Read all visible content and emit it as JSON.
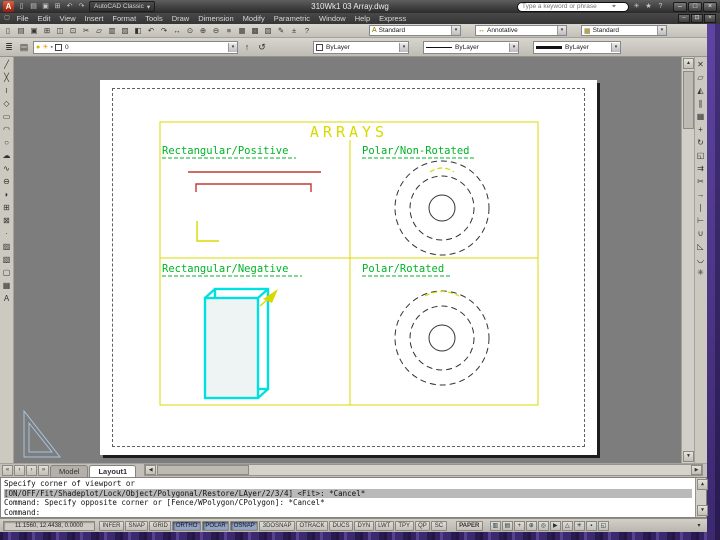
{
  "colors": {
    "cad_yellow": "#d9d900",
    "cad_green": "#00b428",
    "cad_red": "#c03a32",
    "cad_cyan": "#00e0e0",
    "desktop_purple": "#4b2d8e",
    "chrome_dark": "#3a3a3a",
    "canvas_gray": "#7d7d7d"
  },
  "ui": {
    "dropdown_arrow": "▾",
    "search_icon": "⌖",
    "scroll_up": "▲",
    "scroll_down": "▼",
    "scroll_left": "◀",
    "scroll_right": "▶"
  },
  "titlebar": {
    "logo": "A",
    "workspace": "AutoCAD Classic",
    "doc_title": "310Wk1 03 Array.dwg",
    "search_placeholder": "Type a keyword or phrase",
    "qat_icons": [
      {
        "name": "qnew-icon",
        "glyph": "▯"
      },
      {
        "name": "open-icon",
        "glyph": "▤"
      },
      {
        "name": "save-icon",
        "glyph": "▣"
      },
      {
        "name": "plot-icon",
        "glyph": "⊞"
      },
      {
        "name": "undo-icon",
        "glyph": "↶"
      },
      {
        "name": "redo-icon",
        "glyph": "↷"
      }
    ],
    "right_icons": [
      {
        "name": "communication-center-icon",
        "glyph": "☀"
      },
      {
        "name": "favorites-icon",
        "glyph": "★"
      },
      {
        "name": "help-icon",
        "glyph": "?"
      }
    ],
    "window_buttons": [
      {
        "name": "app-minimize-button",
        "glyph": "–"
      },
      {
        "name": "app-maximize-button",
        "glyph": "□"
      },
      {
        "name": "app-close-button",
        "glyph": "×"
      }
    ]
  },
  "menubar": {
    "items": [
      "File",
      "Edit",
      "View",
      "Insert",
      "Format",
      "Tools",
      "Draw",
      "Dimension",
      "Modify",
      "Parametric",
      "Window",
      "Help",
      "Express"
    ],
    "window_buttons": [
      {
        "name": "doc-minimize-button",
        "glyph": "–"
      },
      {
        "name": "doc-restore-button",
        "glyph": "⊡"
      },
      {
        "name": "doc-close-button",
        "glyph": "×"
      }
    ]
  },
  "toolbar1": {
    "icons": [
      {
        "name": "qnew-icon",
        "glyph": "▯"
      },
      {
        "name": "open-icon",
        "glyph": "▤"
      },
      {
        "name": "save-icon",
        "glyph": "▣"
      },
      {
        "name": "plot-icon",
        "glyph": "⊞"
      },
      {
        "name": "plot-preview-icon",
        "glyph": "◫"
      },
      {
        "name": "publish-icon",
        "glyph": "⊡"
      },
      {
        "name": "cut-icon",
        "glyph": "✂"
      },
      {
        "name": "copy-clip-icon",
        "glyph": "▱"
      },
      {
        "name": "paste-icon",
        "glyph": "▥"
      },
      {
        "name": "match-properties-icon",
        "glyph": "▨"
      },
      {
        "name": "block-editor-icon",
        "glyph": "◧"
      },
      {
        "name": "undo-icon",
        "glyph": "↶"
      },
      {
        "name": "redo-icon",
        "glyph": "↷"
      },
      {
        "name": "pan-icon",
        "glyph": "↔"
      },
      {
        "name": "zoom-realtime-icon",
        "glyph": "⊙"
      },
      {
        "name": "zoom-window-icon",
        "glyph": "⊕"
      },
      {
        "name": "zoom-previous-icon",
        "glyph": "⊖"
      },
      {
        "name": "properties-icon",
        "glyph": "≡"
      },
      {
        "name": "designcenter-icon",
        "glyph": "▦"
      },
      {
        "name": "tool-palettes-icon",
        "glyph": "▩"
      },
      {
        "name": "sheetset-manager-icon",
        "glyph": "▧"
      },
      {
        "name": "markup-icon",
        "glyph": "✎"
      },
      {
        "name": "quickcalc-icon",
        "glyph": "±"
      },
      {
        "name": "help-icon",
        "glyph": "?"
      }
    ]
  },
  "styles": {
    "text_style_icon": "A",
    "text_style": "Standard",
    "dim_style_icon": "↔",
    "dim_style": "Annotative",
    "table_style_icon": "▦",
    "table_style": "Standard"
  },
  "layers": {
    "current": "0",
    "indicators": [
      {
        "glyph": "●"
      },
      {
        "glyph": "☀"
      },
      {
        "glyph": "▪"
      }
    ],
    "left_icons": [
      {
        "name": "layer-properties-icon",
        "glyph": "≣"
      },
      {
        "name": "layer-states-icon",
        "glyph": "▤"
      }
    ],
    "mid_icons": [
      {
        "name": "make-object-layer-current-icon",
        "glyph": "↑"
      },
      {
        "name": "layer-previous-icon",
        "glyph": "↺"
      }
    ]
  },
  "properties": {
    "color": "ByLayer",
    "linetype": "ByLayer",
    "lineweight": "ByLayer"
  },
  "draw_toolbar": {
    "icons": [
      {
        "name": "line-icon",
        "glyph": "╱"
      },
      {
        "name": "construction-line-icon",
        "glyph": "╳"
      },
      {
        "name": "polyline-icon",
        "glyph": "≀"
      },
      {
        "name": "polygon-icon",
        "glyph": "◇"
      },
      {
        "name": "rectangle-icon",
        "glyph": "▭"
      },
      {
        "name": "arc-icon",
        "glyph": "◠"
      },
      {
        "name": "circle-icon",
        "glyph": "○"
      },
      {
        "name": "revision-cloud-icon",
        "glyph": "☁"
      },
      {
        "name": "spline-icon",
        "glyph": "∿"
      },
      {
        "name": "ellipse-icon",
        "glyph": "⊖"
      },
      {
        "name": "ellipse-arc-icon",
        "glyph": "◗"
      },
      {
        "name": "insert-block-icon",
        "glyph": "⊞"
      },
      {
        "name": "make-block-icon",
        "glyph": "⊠"
      },
      {
        "name": "point-icon",
        "glyph": "·"
      },
      {
        "name": "hatch-icon",
        "glyph": "▨"
      },
      {
        "name": "gradient-icon",
        "glyph": "▧"
      },
      {
        "name": "region-icon",
        "glyph": "▢"
      },
      {
        "name": "table-icon",
        "glyph": "▦"
      },
      {
        "name": "multiline-text-icon",
        "glyph": "A"
      }
    ]
  },
  "modify_toolbar": {
    "icons": [
      {
        "name": "erase-icon",
        "glyph": "✕"
      },
      {
        "name": "copy-icon",
        "glyph": "▱"
      },
      {
        "name": "mirror-icon",
        "glyph": "◭"
      },
      {
        "name": "offset-icon",
        "glyph": "∥"
      },
      {
        "name": "array-icon",
        "glyph": "▦"
      },
      {
        "name": "move-icon",
        "glyph": "+"
      },
      {
        "name": "rotate-icon",
        "glyph": "↻"
      },
      {
        "name": "scale-icon",
        "glyph": "◱"
      },
      {
        "name": "stretch-icon",
        "glyph": "⇉"
      },
      {
        "name": "trim-icon",
        "glyph": "✂"
      },
      {
        "name": "extend-icon",
        "glyph": "→"
      },
      {
        "name": "break-at-point-icon",
        "glyph": "∣"
      },
      {
        "name": "break-icon",
        "glyph": "⊢"
      },
      {
        "name": "join-icon",
        "glyph": "∪"
      },
      {
        "name": "chamfer-icon",
        "glyph": "◺"
      },
      {
        "name": "fillet-icon",
        "glyph": "◡"
      },
      {
        "name": "explode-icon",
        "glyph": "✳"
      }
    ]
  },
  "drawing": {
    "title": "ARRAYS",
    "labels": {
      "top_left": "Rectangular/Positive",
      "top_right": "Polar/Non-Rotated",
      "bottom_left": "Rectangular/Negative",
      "bottom_right": "Polar/Rotated"
    }
  },
  "tabs": {
    "nav": [
      {
        "name": "tab-first-button",
        "glyph": "«"
      },
      {
        "name": "tab-prev-button",
        "glyph": "‹"
      },
      {
        "name": "tab-next-button",
        "glyph": "›"
      },
      {
        "name": "tab-last-button",
        "glyph": "»"
      }
    ],
    "items": [
      {
        "name": "tab-model",
        "label": "Model",
        "active": false
      },
      {
        "name": "tab-layout1",
        "label": "Layout1",
        "active": true
      }
    ]
  },
  "command": {
    "lines": [
      {
        "text": "Specify corner of viewport or",
        "highlight": false
      },
      {
        "text": "[ON/OFF/Fit/Shadeplot/Lock/Object/Polygonal/Restore/LAyer/2/3/4] <Fit>: *Cancel*",
        "highlight": true
      },
      {
        "text": "Command: Specify opposite corner or [Fence/WPolygon/CPolygon]: *Cancel*",
        "highlight": false
      },
      {
        "text": "Command:",
        "highlight": false
      }
    ]
  },
  "status": {
    "coords": "11.1560, 12.4438, 0.0000",
    "toggles": [
      {
        "name": "toggle-infer",
        "label": "INFER",
        "pressed": false
      },
      {
        "name": "toggle-snap",
        "label": "SNAP",
        "pressed": false
      },
      {
        "name": "toggle-grid",
        "label": "GRID",
        "pressed": false
      },
      {
        "name": "toggle-ortho",
        "label": "ORTHO",
        "pressed": true
      },
      {
        "name": "toggle-polar",
        "label": "POLAR",
        "pressed": true
      },
      {
        "name": "toggle-osnap",
        "label": "OSNAP",
        "pressed": true
      },
      {
        "name": "toggle-3dosnap",
        "label": "3DOSNAP",
        "pressed": false
      },
      {
        "name": "toggle-otrack",
        "label": "OTRACK",
        "pressed": false
      },
      {
        "name": "toggle-ducs",
        "label": "DUCS",
        "pressed": false
      },
      {
        "name": "toggle-dyn",
        "label": "DYN",
        "pressed": false
      },
      {
        "name": "toggle-lwt",
        "label": "LWT",
        "pressed": false
      },
      {
        "name": "toggle-tpy",
        "label": "TPY",
        "pressed": false
      },
      {
        "name": "toggle-qp",
        "label": "QP",
        "pressed": false
      },
      {
        "name": "toggle-sc",
        "label": "SC",
        "pressed": false
      }
    ],
    "space_button": "PAPER",
    "right_icons": [
      {
        "name": "quick-view-layouts-icon",
        "glyph": "▥"
      },
      {
        "name": "quick-view-drawings-icon",
        "glyph": "▤"
      },
      {
        "name": "status-pan-icon",
        "glyph": "+"
      },
      {
        "name": "status-zoom-icon",
        "glyph": "⊕"
      },
      {
        "name": "steering-wheel-icon",
        "glyph": "◎"
      },
      {
        "name": "show-motion-icon",
        "glyph": "▶"
      },
      {
        "name": "annotation-scale-icon",
        "glyph": "△"
      },
      {
        "name": "workspace-switch-icon",
        "glyph": "✳"
      },
      {
        "name": "toolbar-lock-icon",
        "glyph": "▪"
      },
      {
        "name": "clean-screen-icon",
        "glyph": "◱"
      }
    ],
    "tray_arrow": "▾"
  }
}
